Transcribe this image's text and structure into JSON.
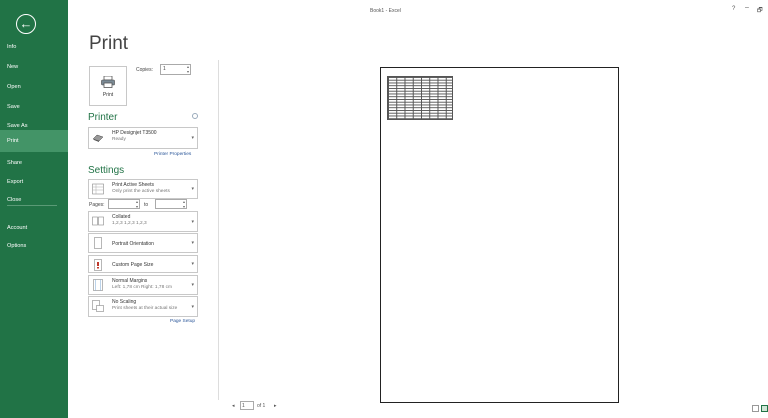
{
  "window": {
    "title": "Book1 - Excel",
    "help": "?",
    "minimize": "–",
    "maximize": "🗗"
  },
  "sidebar": {
    "back_icon": "←",
    "items": [
      {
        "label": "Info"
      },
      {
        "label": "New"
      },
      {
        "label": "Open"
      },
      {
        "label": "Save"
      },
      {
        "label": "Save As"
      },
      {
        "label": "Print",
        "active": true
      },
      {
        "label": "Share"
      },
      {
        "label": "Export"
      },
      {
        "label": "Close"
      },
      {
        "label": "Account"
      },
      {
        "label": "Options"
      }
    ]
  },
  "print": {
    "title": "Print",
    "button_label": "Print",
    "copies_label": "Copies:",
    "copies_value": "1"
  },
  "printer": {
    "heading": "Printer",
    "name": "HP Designjet T3500",
    "status": "Ready",
    "properties_link": "Printer Properties"
  },
  "settings": {
    "heading": "Settings",
    "what_to_print": {
      "title": "Print Active Sheets",
      "subtitle": "Only print the active sheets"
    },
    "pages_label": "Pages:",
    "to_label": "to",
    "collation": {
      "title": "Collated",
      "subtitle": "1,2,3   1,2,3   1,2,3"
    },
    "orientation": "Portrait Orientation",
    "paper_size": "Custom Page Size",
    "margins": {
      "title": "Normal Margins",
      "subtitle": "Left: 1,78 cm    Right: 1,78 cm"
    },
    "scaling": {
      "title": "No Scaling",
      "subtitle": "Print sheets at their actual size"
    },
    "page_setup_link": "Page Setup"
  },
  "preview_nav": {
    "prev": "◂",
    "current_page": "1",
    "of_label": "of 1",
    "next": "▸"
  },
  "colors": {
    "accent": "#217346",
    "active_item": "#439467",
    "link": "#2a5699"
  }
}
